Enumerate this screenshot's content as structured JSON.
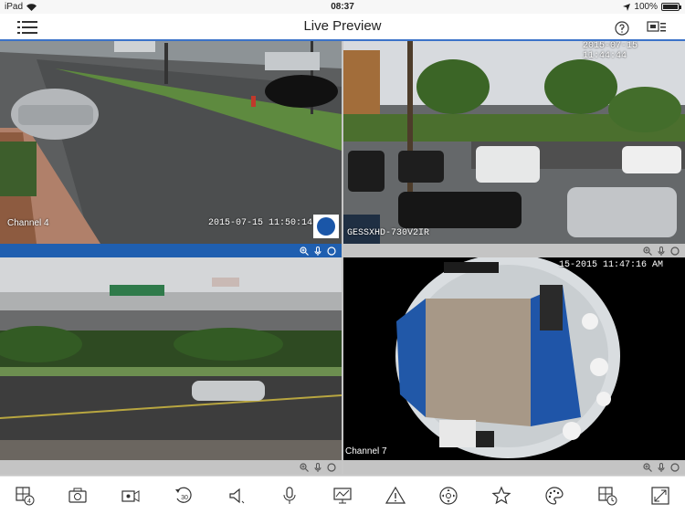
{
  "status_bar": {
    "device": "iPad",
    "time": "08:37",
    "battery": "100%"
  },
  "nav": {
    "title": "Live Preview"
  },
  "channels": [
    {
      "label": "Channel 4",
      "timestamp": "2015-07-15 11:50:14"
    },
    {
      "label": "",
      "timestamp": "2015-07-15 11:44:44",
      "overlay": "GESSXHD-730V2IR"
    },
    {
      "label": "",
      "timestamp": ""
    },
    {
      "label": "Channel 7",
      "timestamp": "15-2015 11:47:16 AM"
    }
  ],
  "colors": {
    "accent": "#3b73c9",
    "strip_active": "#1f5fb0",
    "strip_inactive": "#c4c4c4"
  },
  "toolbar_icons": [
    "split-window-icon",
    "snapshot-icon",
    "record-icon",
    "playback-icon",
    "speaker-icon",
    "microphone-icon",
    "monitor-icon",
    "alarm-icon",
    "ptz-icon",
    "favorite-icon",
    "color-adjust-icon",
    "window-schedule-icon",
    "fullscreen-icon"
  ]
}
